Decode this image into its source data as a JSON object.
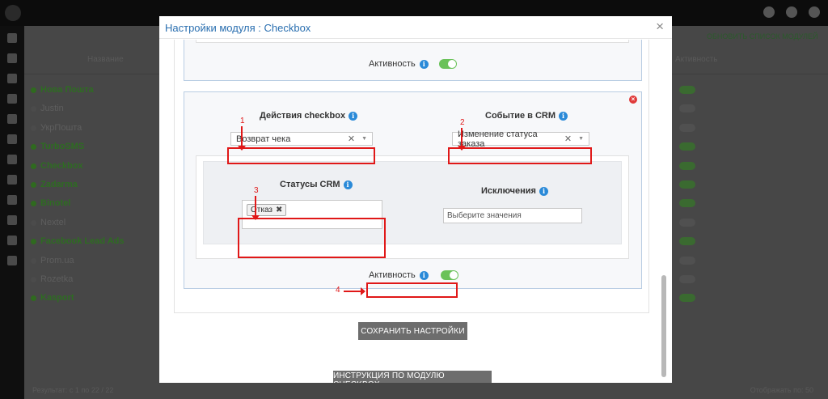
{
  "colors": {
    "accent": "#2a6fb0",
    "annotation": "#e01818",
    "toggle_on": "#6ac259",
    "button": "#6d6d6d"
  },
  "background": {
    "refresh_label": "ОБНОВИТЬ СПИСОК МОДУЛЕЙ",
    "col_name": "Название",
    "col_activity": "Активность",
    "modules": [
      {
        "name": "Нова Пошта",
        "active": true
      },
      {
        "name": "Justin",
        "active": false
      },
      {
        "name": "УкрПошта",
        "active": false
      },
      {
        "name": "TurboSMS",
        "active": true
      },
      {
        "name": "Checkbox",
        "active": true
      },
      {
        "name": "Zadarma",
        "active": true
      },
      {
        "name": "Binotel",
        "active": true
      },
      {
        "name": "Nextel",
        "active": false
      },
      {
        "name": "Facebook Lead Ads",
        "active": true
      },
      {
        "name": "Prom.ua",
        "active": false
      },
      {
        "name": "Rozetka",
        "active": false
      },
      {
        "name": "Kasport",
        "active": true
      }
    ],
    "footer_left": "Результат: с 1 по 22 / 22",
    "footer_right": "Отображать по: 50"
  },
  "modal": {
    "title": "Настройки модуля : Checkbox",
    "close_icon": "×",
    "block1": {
      "activity_label": "Активность"
    },
    "block2": {
      "checkbox_action_label": "Действия checkbox",
      "checkbox_action_value": "Возврат чека",
      "crm_event_label": "Событие в CRM",
      "crm_event_value": "Изменение статуса заказа",
      "crm_statuses_label": "Статусы CRM",
      "crm_statuses_tags": [
        "Отказ"
      ],
      "exclusions_label": "Исключения",
      "exclusions_placeholder": "Выберите значения",
      "activity_label": "Активность"
    },
    "annotations": [
      "1",
      "2",
      "3",
      "4"
    ],
    "save_button": "СОХРАНИТЬ НАСТРОЙКИ",
    "instruction_button": "ИНСТРУКЦИЯ ПО МОДУЛЮ CHECKBOX"
  }
}
